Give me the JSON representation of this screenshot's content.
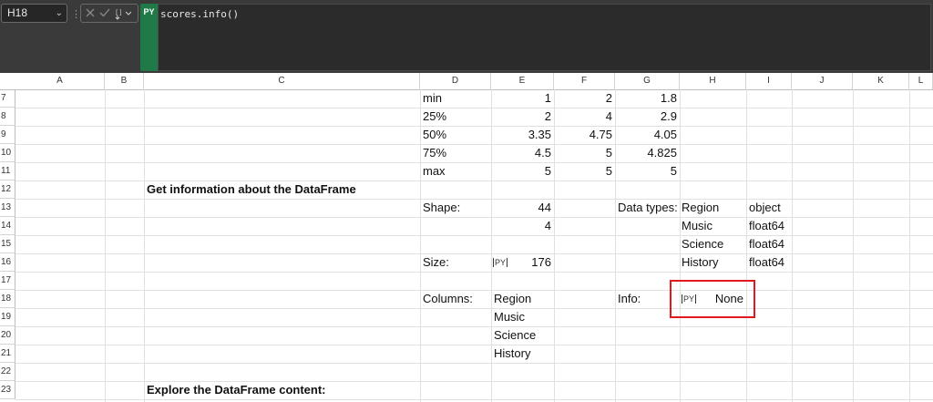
{
  "formula_bar": {
    "name_box": "H18",
    "py_badge": "PY",
    "formula": "scores.info()"
  },
  "columns": [
    "A",
    "B",
    "C",
    "D",
    "E",
    "F",
    "G",
    "H",
    "I",
    "J",
    "K",
    "L"
  ],
  "rows": [
    "7",
    "8",
    "9",
    "10",
    "11",
    "12",
    "13",
    "14",
    "15",
    "16",
    "17",
    "18",
    "19",
    "20",
    "21",
    "22",
    "23"
  ],
  "describe": {
    "labels": [
      "min",
      "25%",
      "50%",
      "75%",
      "max"
    ],
    "E": [
      "1",
      "2",
      "3.35",
      "4.5",
      "5"
    ],
    "F": [
      "2",
      "4",
      "4.75",
      "5",
      "5"
    ],
    "G": [
      "1.8",
      "2.9",
      "4.05",
      "4.825",
      "5"
    ]
  },
  "section1_title": "Get information about the DataFrame",
  "shape": {
    "label": "Shape:",
    "rows": "44",
    "cols": "4"
  },
  "size": {
    "label": "Size:",
    "value": "176"
  },
  "columns_info": {
    "label": "Columns:",
    "names": [
      "Region",
      "Music",
      "Science",
      "History"
    ]
  },
  "data_types": {
    "label": "Data types:",
    "names": [
      "Region",
      "Music",
      "Science",
      "History"
    ],
    "types": [
      "object",
      "float64",
      "float64",
      "float64"
    ]
  },
  "info": {
    "label": "Info:",
    "value": "None"
  },
  "section2_title": "Explore the DataFrame content:",
  "colors": {
    "py_green": "#1f7a48",
    "highlight_red": "#e0191f"
  }
}
